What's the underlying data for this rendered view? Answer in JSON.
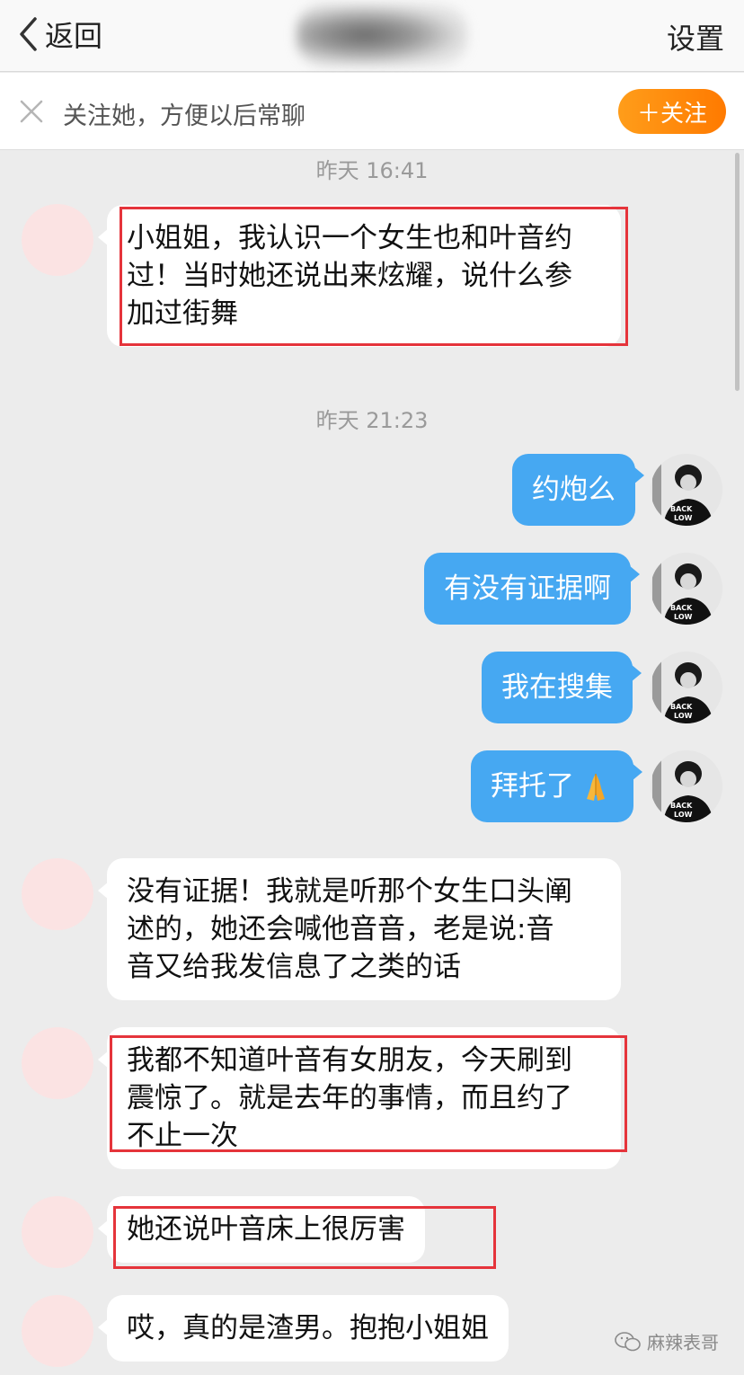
{
  "header": {
    "back_label": "返回",
    "settings_label": "设置"
  },
  "follow_bar": {
    "prompt": "关注她，方便以后常聊",
    "follow_button": "＋关注"
  },
  "timestamps": [
    "昨天 16:41",
    "昨天 21:23"
  ],
  "messages": [
    {
      "side": "left",
      "lines": [
        "小姐姐，我认识一个女生也和叶音约",
        "过！当时她还说出来炫耀，说什么参",
        "加过街舞"
      ],
      "highlighted": true
    },
    {
      "side": "right",
      "text": "约炮么"
    },
    {
      "side": "right",
      "text": "有没有证据啊"
    },
    {
      "side": "right",
      "text": "我在搜集"
    },
    {
      "side": "right",
      "text": "拜托了",
      "emoji": "pray-emoji"
    },
    {
      "side": "left",
      "lines": [
        "没有证据！我就是听那个女生口头阐",
        "述的，她还会喊他音音，老是说:音",
        "音又给我发信息了之类的话"
      ],
      "highlighted": false
    },
    {
      "side": "left",
      "lines": [
        "我都不知道叶音有女朋友，今天刷到",
        "震惊了。就是去年的事情，而且约了",
        "不止一次"
      ],
      "highlighted": true
    },
    {
      "side": "left",
      "lines": [
        "她还说叶音床上很厉害"
      ],
      "highlighted": true
    },
    {
      "side": "left",
      "lines": [
        "哎，真的是渣男。抱抱小姐姐"
      ],
      "highlighted": false
    }
  ],
  "avatar_right": {
    "shirt_text": "BACK LOW",
    "icon": "user-avatar-photo"
  },
  "watermark": {
    "text": "麻辣表哥",
    "icon": "wechat-icon"
  },
  "colors": {
    "bubble_right": "#46a8f2",
    "follow_button": "#ff8a00",
    "highlight": "#e5343b",
    "avatar_left": "#fbe3e3"
  }
}
